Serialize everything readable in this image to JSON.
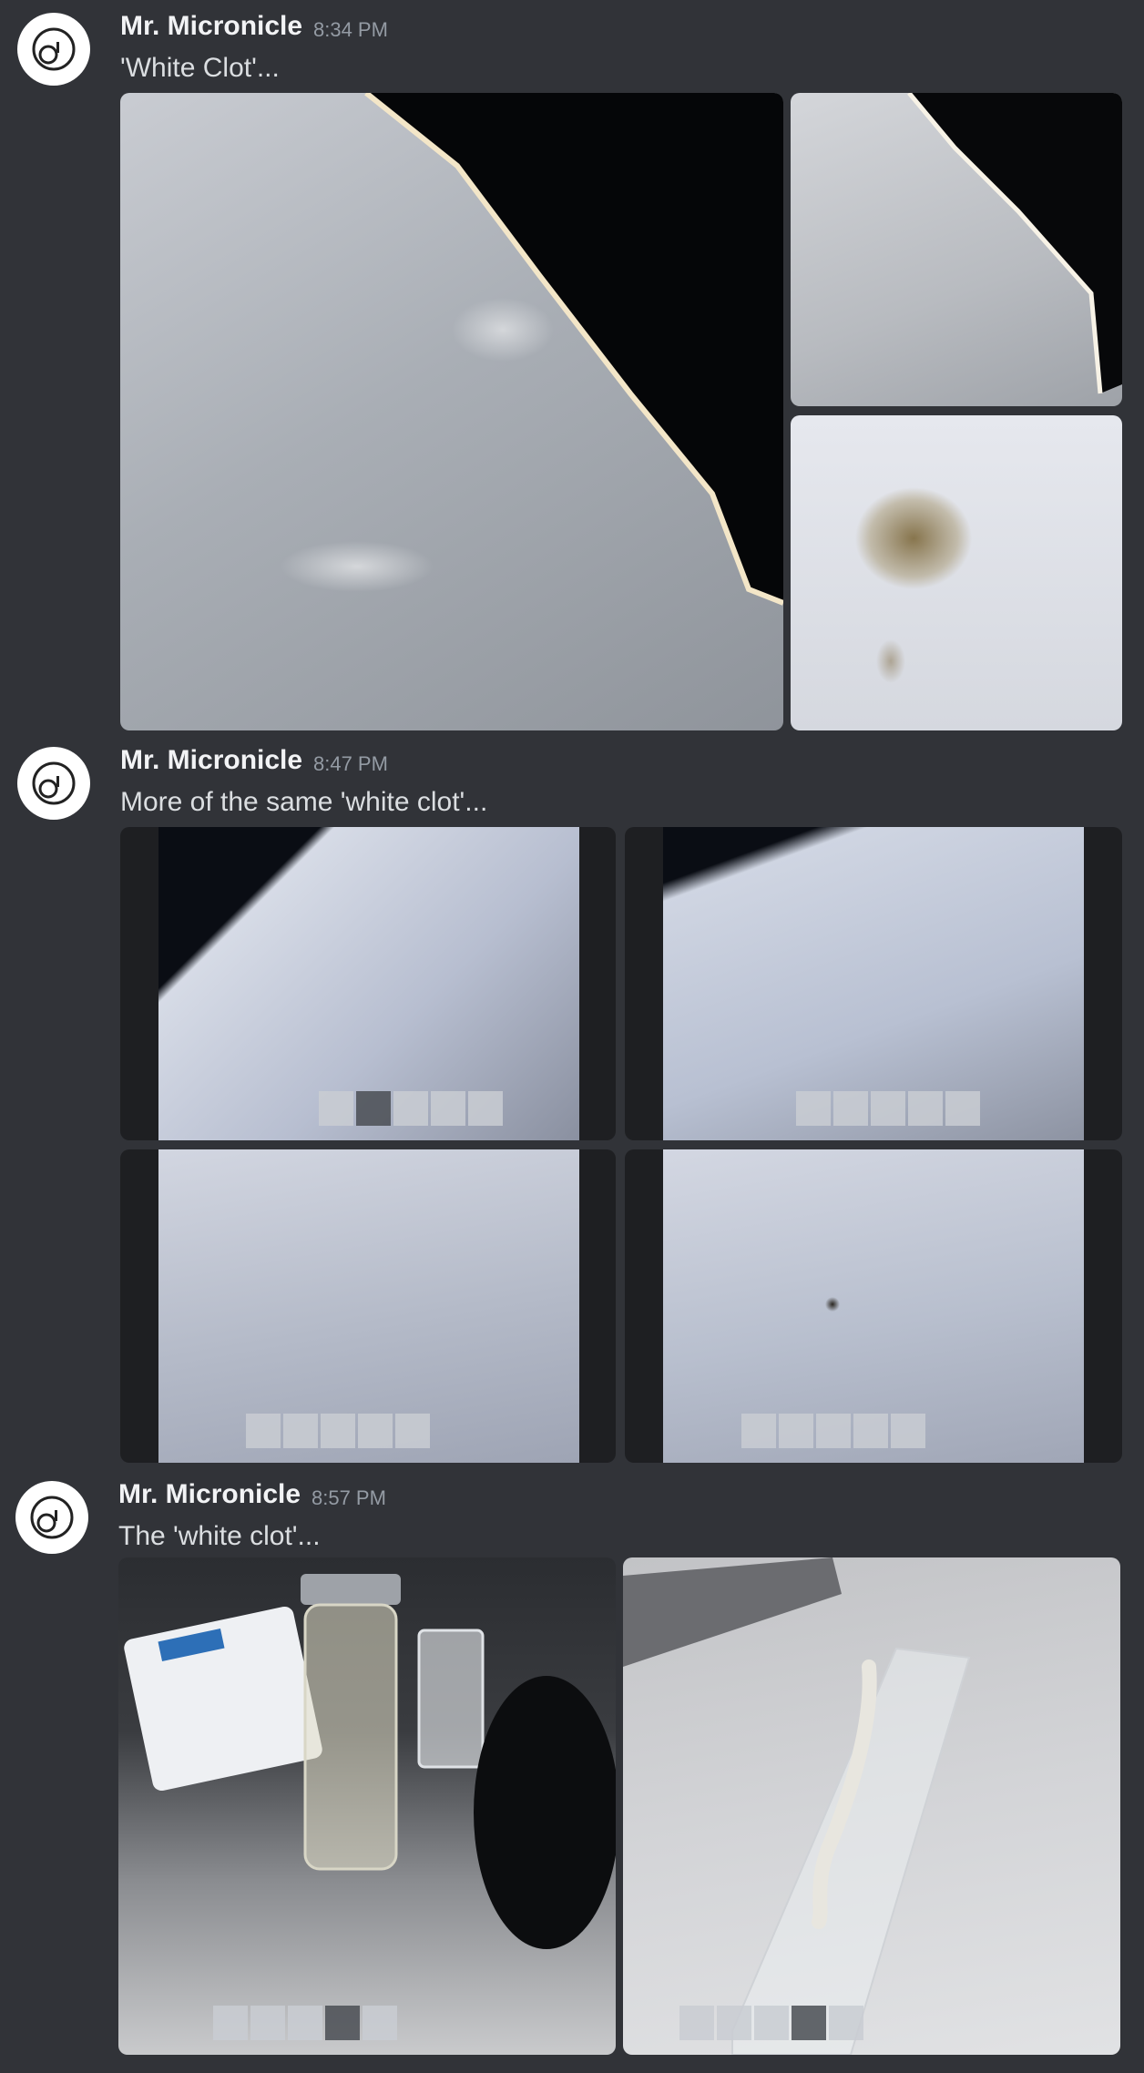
{
  "messages": [
    {
      "author": "Mr. Micronicle",
      "time": "8:34 PM",
      "text": "'White Clot'...",
      "attachments": [
        "microscope-image-1",
        "microscope-image-2",
        "microscope-image-3"
      ]
    },
    {
      "author": "Mr. Micronicle",
      "time": "8:47 PM",
      "text": "More of the same 'white clot'...",
      "attachments": [
        "screenshot-1",
        "screenshot-2",
        "screenshot-3",
        "screenshot-4"
      ]
    },
    {
      "author": "Mr. Micronicle",
      "time": "8:57 PM",
      "text": "The 'white clot'...",
      "attachments": [
        "photo-vial",
        "photo-slide"
      ]
    }
  ],
  "colors": {
    "background": "#313338",
    "username": "#f2f3f5",
    "timestamp": "#949ba4",
    "message_text": "#dbdee1"
  },
  "icons": {
    "avatar": "micronicle-logo-icon"
  }
}
